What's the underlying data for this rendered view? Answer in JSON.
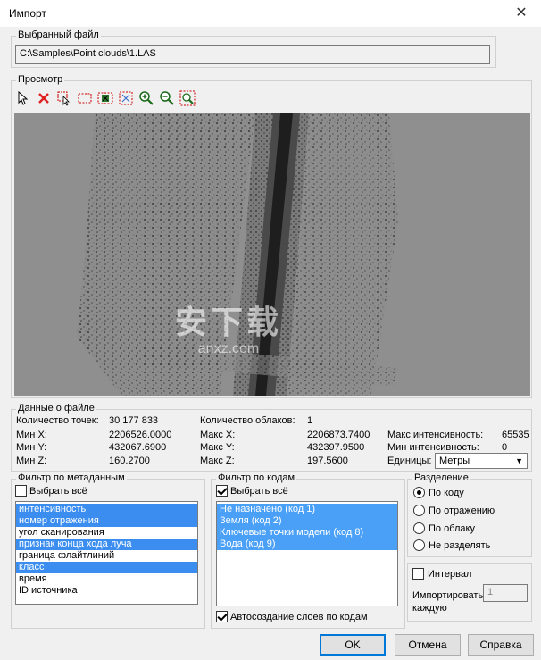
{
  "window": {
    "title": "Импорт",
    "close_glyph": "✕"
  },
  "selected_file": {
    "group_label": "Выбранный файл",
    "path": "C:\\Samples\\Point clouds\\1.LAS"
  },
  "preview": {
    "group_label": "Просмотр",
    "tools": [
      "select-arrow-icon",
      "delete-icon",
      "select-region-icon",
      "dashed-rect-icon",
      "pan-icon",
      "fit-icon",
      "zoom-in-icon",
      "zoom-out-icon",
      "zoom-window-icon"
    ]
  },
  "file_info": {
    "group_label": "Данные о файле",
    "points_label": "Количество точек:",
    "points_value": "30 177 833",
    "clouds_label": "Количество облаков:",
    "clouds_value": "1",
    "minx_label": "Мин X:",
    "minx_value": "2206526.0000",
    "miny_label": "Мин Y:",
    "miny_value": "432067.6900",
    "minz_label": "Мин Z:",
    "minz_value": "160.2700",
    "maxx_label": "Макс X:",
    "maxx_value": "2206873.7400",
    "maxy_label": "Макс Y:",
    "maxy_value": "432397.9500",
    "maxz_label": "Макс Z:",
    "maxz_value": "197.5600",
    "maxint_label": "Макс интенсивность:",
    "maxint_value": "65535",
    "minint_label": "Мин интенсивность:",
    "minint_value": "0",
    "units_label": "Единицы:",
    "units_value": "Метры"
  },
  "meta_filter": {
    "group_label": "Фильтр по метаданным",
    "select_all": "Выбрать всё",
    "select_all_checked": false,
    "items": [
      {
        "label": "интенсивность",
        "selected": true
      },
      {
        "label": "номер отражения",
        "selected": true
      },
      {
        "label": "угол сканирования",
        "selected": false
      },
      {
        "label": "признак конца хода луча",
        "selected": true
      },
      {
        "label": "граница флайтлиний",
        "selected": false
      },
      {
        "label": "класс",
        "selected": true
      },
      {
        "label": "время",
        "selected": false
      },
      {
        "label": "ID источника",
        "selected": false
      }
    ]
  },
  "code_filter": {
    "group_label": "Фильтр по кодам",
    "select_all": "Выбрать всё",
    "select_all_checked": true,
    "items": [
      {
        "label": "Не назначено (код 1)",
        "selected": true
      },
      {
        "label": "Земля (код 2)",
        "selected": true
      },
      {
        "label": "Ключевые точки модели (код 8)",
        "selected": true
      },
      {
        "label": "Вода (код 9)",
        "selected": true
      }
    ],
    "auto_layers": "Автосоздание слоев по кодам",
    "auto_layers_checked": true
  },
  "split": {
    "group_label": "Разделение",
    "options": [
      {
        "label": "По коду",
        "checked": true
      },
      {
        "label": "По отражению",
        "checked": false
      },
      {
        "label": "По облаку",
        "checked": false
      },
      {
        "label": "Не разделять",
        "checked": false
      }
    ]
  },
  "interval": {
    "label": "Интервал",
    "checked": false,
    "import_every": "Импортировать каждую",
    "value": "1"
  },
  "buttons": {
    "ok": "OK",
    "cancel": "Отмена",
    "help": "Справка"
  },
  "watermark": {
    "text": "安下载",
    "sub": "anxz.com"
  }
}
